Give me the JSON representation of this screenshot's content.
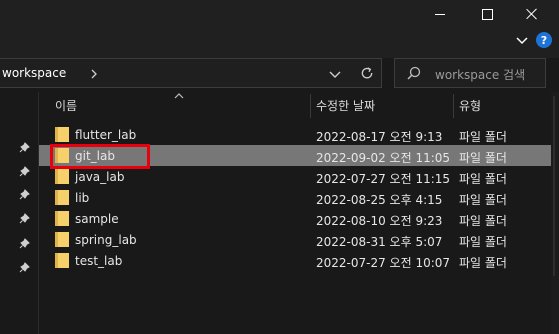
{
  "window": {
    "breadcrumb": "workspace",
    "search_placeholder": "workspace 검색",
    "help_label": "?"
  },
  "columns": {
    "name": "이름",
    "date": "수정한 날짜",
    "type": "유형"
  },
  "files": [
    {
      "name": "flutter_lab",
      "date": "2022-08-17 오전 9:13",
      "type": "파일 폴더"
    },
    {
      "name": "git_lab",
      "date": "2022-09-02 오전 11:05",
      "type": "파일 폴더"
    },
    {
      "name": "java_lab",
      "date": "2022-07-27 오전 11:15",
      "type": "파일 폴더"
    },
    {
      "name": "lib",
      "date": "2022-08-25 오후 4:15",
      "type": "파일 폴더"
    },
    {
      "name": "sample",
      "date": "2022-08-10 오전 9:23",
      "type": "파일 폴더"
    },
    {
      "name": "spring_lab",
      "date": "2022-08-31 오후 5:07",
      "type": "파일 폴더"
    },
    {
      "name": "test_lab",
      "date": "2022-07-27 오전 10:07",
      "type": "파일 폴더"
    }
  ],
  "selected_file": "git_lab",
  "colors": {
    "folder": "#f5d06b",
    "selection": "#777777",
    "highlight_box": "#e8000d",
    "help_icon": "#1e74d6"
  }
}
